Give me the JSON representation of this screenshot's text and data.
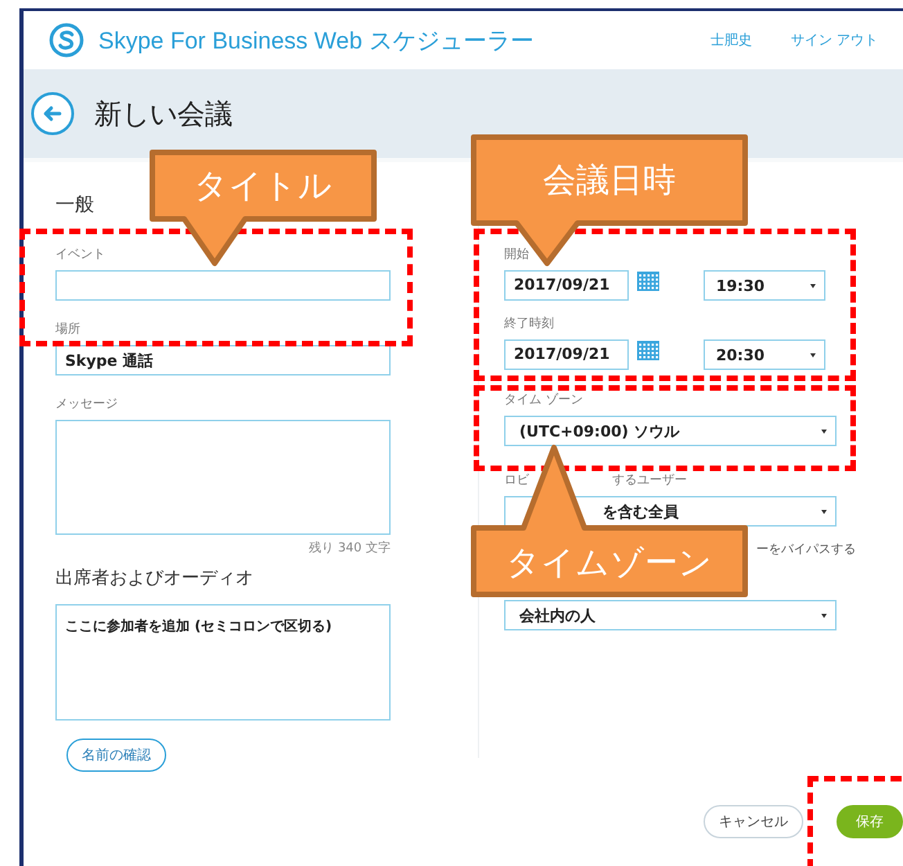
{
  "header": {
    "app_title": "Skype For Business Web スケジューラー",
    "user_name": "士肥史",
    "sign_out": "サイン アウト"
  },
  "page_title": "新しい会議",
  "general": {
    "heading": "一般",
    "fields": [
      {
        "kind": "input",
        "label": "イベント"
      },
      {
        "kind": "input",
        "label": "場所",
        "value": "Skype 通話"
      },
      {
        "kind": "textarea",
        "label": "メッセージ",
        "counter": "残り 340 文字"
      }
    ]
  },
  "attendees": {
    "heading": "出席者およびオーディオ",
    "placeholder": "ここに参加者を追加 (セミコロンで区切る)",
    "check_button": "名前の確認"
  },
  "schedule": [
    {
      "label": "開始",
      "date": "2017/09/21",
      "time": "19:30"
    },
    {
      "label": "終了時刻",
      "date": "2017/09/21",
      "time": "20:30"
    }
  ],
  "timezone": {
    "label": "タイム ゾーン",
    "value": "(UTC+09:00) ソウル"
  },
  "lobby": {
    "label_start": "ロビ",
    "label_end": "するユーザー",
    "value": "を含む全員",
    "checkbox_text": "ーをバイパスする"
  },
  "presenters": {
    "value": "会社内の人"
  },
  "buttons": [
    {
      "kind": "cancel",
      "label": "キャンセル"
    },
    {
      "kind": "save",
      "label": "保存"
    }
  ],
  "callouts": [
    {
      "label": "タイトル"
    },
    {
      "label": "会議日時"
    },
    {
      "label": "タイムゾーン"
    }
  ]
}
